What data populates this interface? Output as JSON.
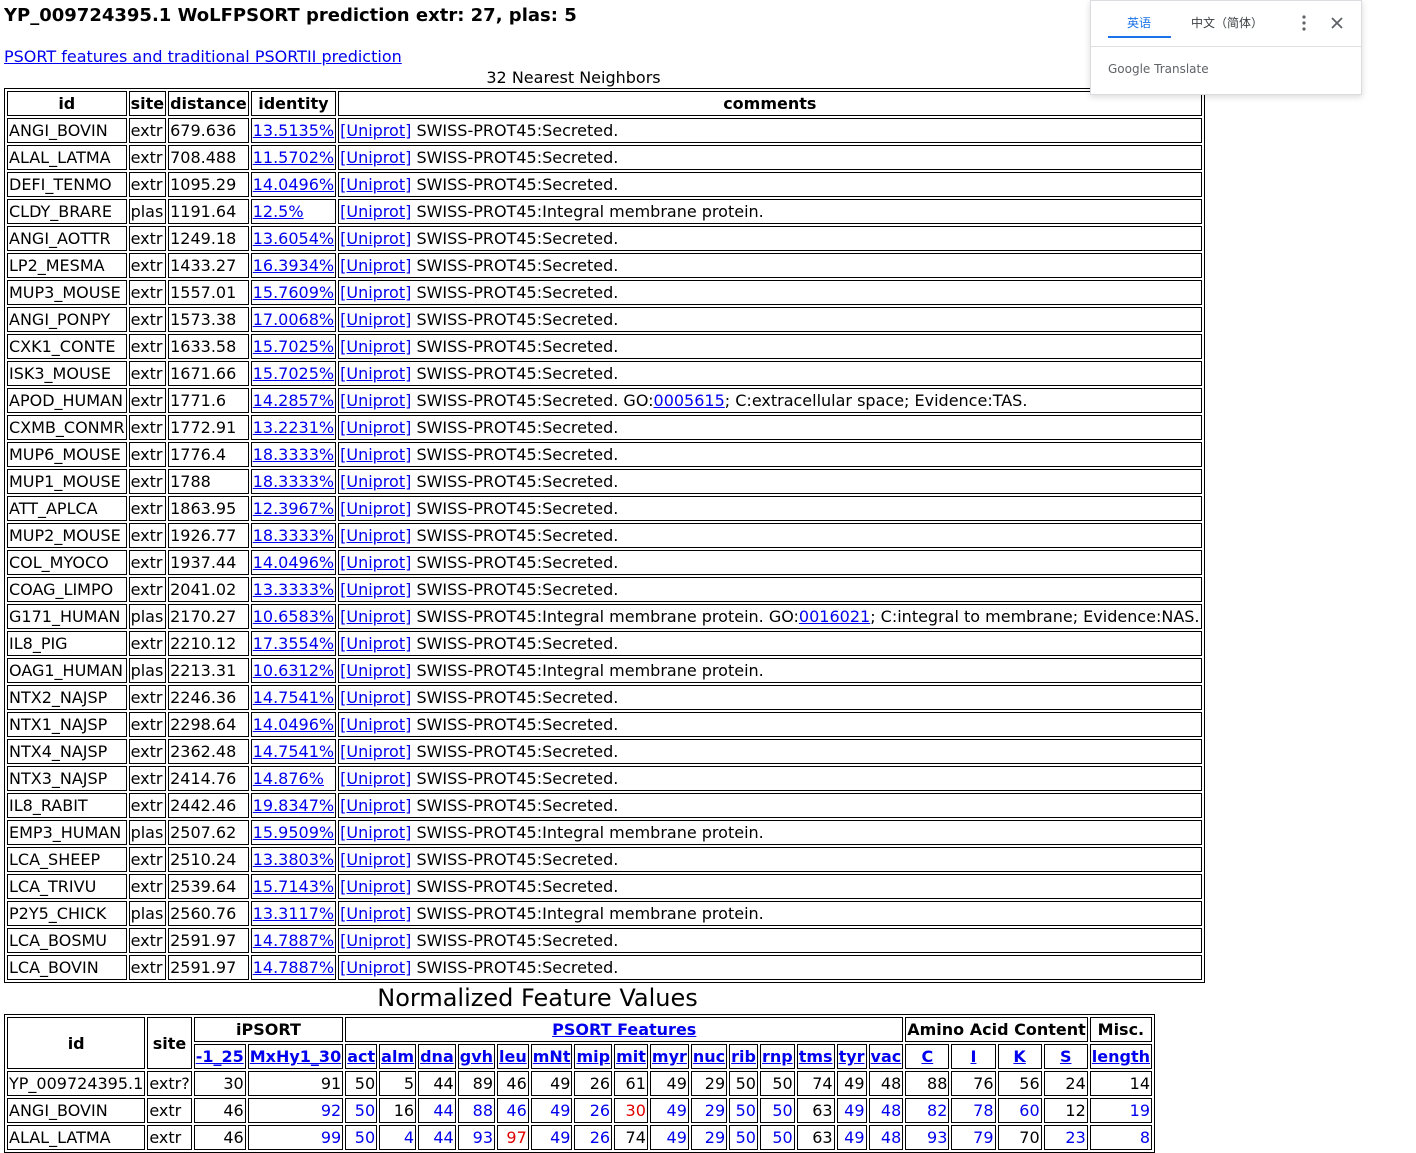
{
  "page": {
    "title": "YP_009724395.1 WoLFPSORT prediction extr: 27, plas: 5",
    "psort_link": "PSORT features and traditional PSORTII prediction",
    "nn_caption": "32 Nearest Neighbors"
  },
  "nn_table": {
    "headers": [
      "id",
      "site",
      "distance",
      "identity",
      "comments"
    ],
    "uniprot_label": "[Uniprot]",
    "rows": [
      {
        "id": "ANGI_BOVIN",
        "site": "extr",
        "distance": "679.636",
        "identity": "13.5135%",
        "comment": "SWISS-PROT45:Secreted."
      },
      {
        "id": "ALAL_LATMA",
        "site": "extr",
        "distance": "708.488",
        "identity": "11.5702%",
        "comment": "SWISS-PROT45:Secreted."
      },
      {
        "id": "DEFI_TENMO",
        "site": "extr",
        "distance": "1095.29",
        "identity": "14.0496%",
        "comment": "SWISS-PROT45:Secreted."
      },
      {
        "id": "CLDY_BRARE",
        "site": "plas",
        "distance": "1191.64",
        "identity": "12.5%",
        "comment": "SWISS-PROT45:Integral membrane protein."
      },
      {
        "id": "ANGI_AOTTR",
        "site": "extr",
        "distance": "1249.18",
        "identity": "13.6054%",
        "comment": "SWISS-PROT45:Secreted."
      },
      {
        "id": "LP2_MESMA",
        "site": "extr",
        "distance": "1433.27",
        "identity": "16.3934%",
        "comment": "SWISS-PROT45:Secreted."
      },
      {
        "id": "MUP3_MOUSE",
        "site": "extr",
        "distance": "1557.01",
        "identity": "15.7609%",
        "comment": "SWISS-PROT45:Secreted."
      },
      {
        "id": "ANGI_PONPY",
        "site": "extr",
        "distance": "1573.38",
        "identity": "17.0068%",
        "comment": "SWISS-PROT45:Secreted."
      },
      {
        "id": "CXK1_CONTE",
        "site": "extr",
        "distance": "1633.58",
        "identity": "15.7025%",
        "comment": "SWISS-PROT45:Secreted."
      },
      {
        "id": "ISK3_MOUSE",
        "site": "extr",
        "distance": "1671.66",
        "identity": "15.7025%",
        "comment": "SWISS-PROT45:Secreted."
      },
      {
        "id": "APOD_HUMAN",
        "site": "extr",
        "distance": "1771.6",
        "identity": "14.2857%",
        "comment": "SWISS-PROT45:Secreted. GO:",
        "go_id": "0005615",
        "go_tail": "; C:extracellular space; Evidence:TAS."
      },
      {
        "id": "CXMB_CONMR",
        "site": "extr",
        "distance": "1772.91",
        "identity": "13.2231%",
        "comment": "SWISS-PROT45:Secreted."
      },
      {
        "id": "MUP6_MOUSE",
        "site": "extr",
        "distance": "1776.4",
        "identity": "18.3333%",
        "comment": "SWISS-PROT45:Secreted."
      },
      {
        "id": "MUP1_MOUSE",
        "site": "extr",
        "distance": "1788",
        "identity": "18.3333%",
        "comment": "SWISS-PROT45:Secreted."
      },
      {
        "id": "ATT_APLCA",
        "site": "extr",
        "distance": "1863.95",
        "identity": "12.3967%",
        "comment": "SWISS-PROT45:Secreted."
      },
      {
        "id": "MUP2_MOUSE",
        "site": "extr",
        "distance": "1926.77",
        "identity": "18.3333%",
        "comment": "SWISS-PROT45:Secreted."
      },
      {
        "id": "COL_MYOCO",
        "site": "extr",
        "distance": "1937.44",
        "identity": "14.0496%",
        "comment": "SWISS-PROT45:Secreted."
      },
      {
        "id": "COAG_LIMPO",
        "site": "extr",
        "distance": "2041.02",
        "identity": "13.3333%",
        "comment": "SWISS-PROT45:Secreted."
      },
      {
        "id": "G171_HUMAN",
        "site": "plas",
        "distance": "2170.27",
        "identity": "10.6583%",
        "comment": "SWISS-PROT45:Integral membrane protein. GO:",
        "go_id": "0016021",
        "go_tail": "; C:integral to membrane; Evidence:NAS."
      },
      {
        "id": "IL8_PIG",
        "site": "extr",
        "distance": "2210.12",
        "identity": "17.3554%",
        "comment": "SWISS-PROT45:Secreted."
      },
      {
        "id": "OAG1_HUMAN",
        "site": "plas",
        "distance": "2213.31",
        "identity": "10.6312%",
        "comment": "SWISS-PROT45:Integral membrane protein."
      },
      {
        "id": "NTX2_NAJSP",
        "site": "extr",
        "distance": "2246.36",
        "identity": "14.7541%",
        "comment": "SWISS-PROT45:Secreted."
      },
      {
        "id": "NTX1_NAJSP",
        "site": "extr",
        "distance": "2298.64",
        "identity": "14.0496%",
        "comment": "SWISS-PROT45:Secreted."
      },
      {
        "id": "NTX4_NAJSP",
        "site": "extr",
        "distance": "2362.48",
        "identity": "14.7541%",
        "comment": "SWISS-PROT45:Secreted."
      },
      {
        "id": "NTX3_NAJSP",
        "site": "extr",
        "distance": "2414.76",
        "identity": "14.876%",
        "comment": "SWISS-PROT45:Secreted."
      },
      {
        "id": "IL8_RABIT",
        "site": "extr",
        "distance": "2442.46",
        "identity": "19.8347%",
        "comment": "SWISS-PROT45:Secreted."
      },
      {
        "id": "EMP3_HUMAN",
        "site": "plas",
        "distance": "2507.62",
        "identity": "15.9509%",
        "comment": "SWISS-PROT45:Integral membrane protein."
      },
      {
        "id": "LCA_SHEEP",
        "site": "extr",
        "distance": "2510.24",
        "identity": "13.3803%",
        "comment": "SWISS-PROT45:Secreted."
      },
      {
        "id": "LCA_TRIVU",
        "site": "extr",
        "distance": "2539.64",
        "identity": "15.7143%",
        "comment": "SWISS-PROT45:Secreted."
      },
      {
        "id": "P2Y5_CHICK",
        "site": "plas",
        "distance": "2560.76",
        "identity": "13.3117%",
        "comment": "SWISS-PROT45:Integral membrane protein."
      },
      {
        "id": "LCA_BOSMU",
        "site": "extr",
        "distance": "2591.97",
        "identity": "14.7887%",
        "comment": "SWISS-PROT45:Secreted."
      },
      {
        "id": "LCA_BOVIN",
        "site": "extr",
        "distance": "2591.97",
        "identity": "14.7887%",
        "comment": "SWISS-PROT45:Secreted."
      }
    ]
  },
  "feature_table": {
    "caption": "Normalized Feature Values",
    "group_headers": {
      "id": "id",
      "site": "site",
      "ipsort": "iPSORT",
      "psort": "PSORT Features",
      "amino": "Amino Acid Content",
      "misc": "Misc."
    },
    "columns": [
      "-1_25",
      "MxHy1_30",
      "act",
      "alm",
      "dna",
      "gvh",
      "leu",
      "mNt",
      "mip",
      "mit",
      "myr",
      "nuc",
      "rib",
      "rnp",
      "tms",
      "tyr",
      "vac",
      "C",
      "I",
      "K",
      "S",
      "length"
    ],
    "rows": [
      {
        "id": "YP_009724395.1",
        "site": "extr?",
        "values": [
          "30",
          "91",
          "50",
          "5",
          "44",
          "89",
          "46",
          "49",
          "26",
          "61",
          "49",
          "29",
          "50",
          "50",
          "74",
          "49",
          "48",
          "88",
          "76",
          "56",
          "24",
          "14"
        ],
        "colors": [
          "k",
          "k",
          "k",
          "k",
          "k",
          "k",
          "k",
          "k",
          "k",
          "k",
          "k",
          "k",
          "k",
          "k",
          "k",
          "k",
          "k",
          "k",
          "k",
          "k",
          "k",
          "k"
        ]
      },
      {
        "id": "ANGI_BOVIN",
        "site": "extr",
        "values": [
          "46",
          "92",
          "50",
          "16",
          "44",
          "88",
          "46",
          "49",
          "26",
          "30",
          "49",
          "29",
          "50",
          "50",
          "63",
          "49",
          "48",
          "82",
          "78",
          "60",
          "12",
          "19"
        ],
        "colors": [
          "k",
          "b",
          "b",
          "k",
          "b",
          "b",
          "b",
          "b",
          "b",
          "r",
          "b",
          "b",
          "b",
          "b",
          "k",
          "b",
          "b",
          "b",
          "b",
          "b",
          "k",
          "b"
        ]
      },
      {
        "id": "ALAL_LATMA",
        "site": "extr",
        "values": [
          "46",
          "99",
          "50",
          "4",
          "44",
          "93",
          "97",
          "49",
          "26",
          "74",
          "49",
          "29",
          "50",
          "50",
          "63",
          "49",
          "48",
          "93",
          "79",
          "70",
          "23",
          "8"
        ],
        "colors": [
          "k",
          "b",
          "b",
          "b",
          "b",
          "b",
          "r",
          "b",
          "b",
          "k",
          "b",
          "b",
          "b",
          "b",
          "k",
          "b",
          "b",
          "b",
          "b",
          "k",
          "b",
          "b"
        ]
      }
    ]
  },
  "translate_popup": {
    "tab_english": "英语",
    "tab_chinese": "中文（简体）",
    "brand": "Google Translate",
    "accent_color": "#1a73e8",
    "menu_icon": "more-vert-icon",
    "close_icon": "close-icon"
  }
}
